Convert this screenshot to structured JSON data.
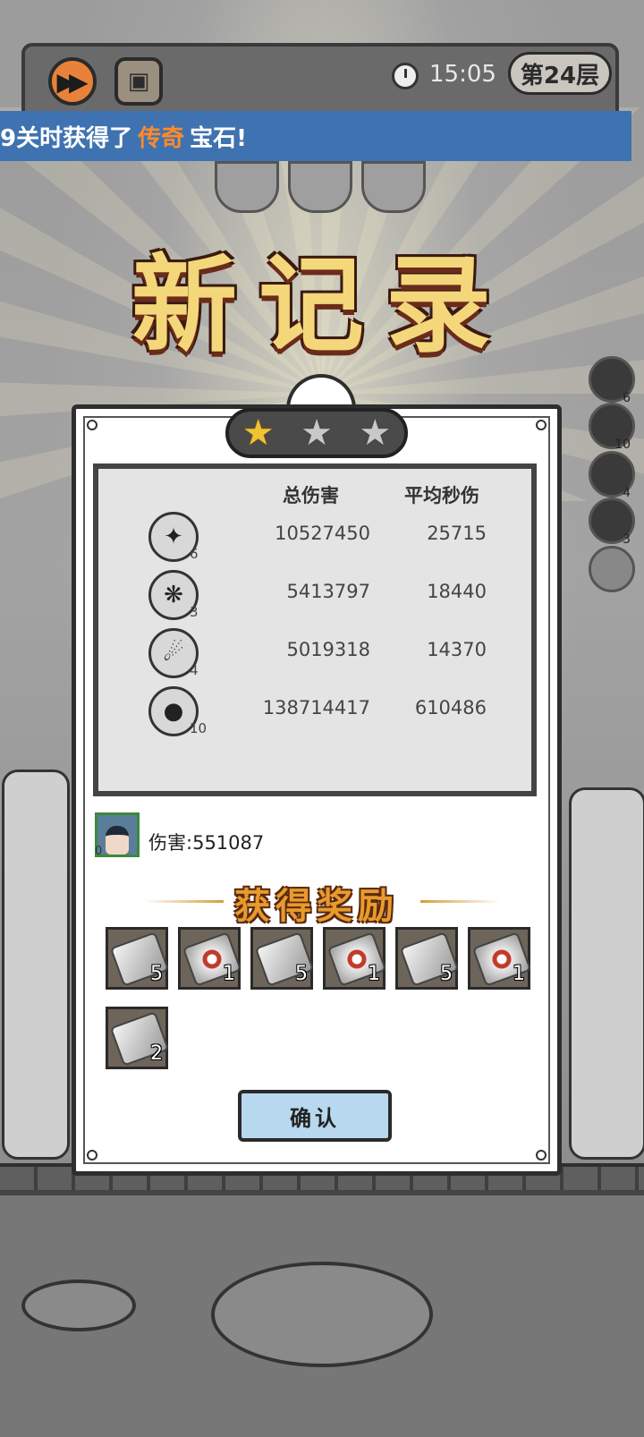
{
  "top_bar": {
    "fast_forward_icon": "fast-forward-icon",
    "chest_icon": "treasure-chest-icon",
    "clock_icon": "clock-icon",
    "time": "15:05",
    "floor": "第24层"
  },
  "banner": {
    "prefix": "9关时获得了",
    "highlight": "传奇",
    "suffix": "宝石!",
    "highlight_color": "#ff8a2a"
  },
  "title": "新记录",
  "stars": {
    "earned": 1,
    "total": 3
  },
  "stats": {
    "headers": {
      "total_damage": "总伤害",
      "avg_dps": "平均秒伤"
    },
    "rows": [
      {
        "icon": "ink-splash-icon",
        "glyph": "✦",
        "level": "6",
        "total": "10527450",
        "dps": "25715"
      },
      {
        "icon": "crystal-cluster-icon",
        "glyph": "❋",
        "level": "3",
        "total": "5413797",
        "dps": "18440"
      },
      {
        "icon": "comet-slash-icon",
        "glyph": "☄",
        "level": "4",
        "total": "5019318",
        "dps": "14370"
      },
      {
        "icon": "bomb-icon",
        "glyph": "●",
        "level": "10",
        "total": "138714417",
        "dps": "610486"
      }
    ]
  },
  "hero": {
    "icon": "hero-avatar",
    "level": "0",
    "damage_label": "伤害:",
    "damage": "551087"
  },
  "rewards": {
    "title": "获得奖励",
    "items": [
      {
        "type": "silver-ore-icon",
        "count": "5"
      },
      {
        "type": "red-gem-ore-icon",
        "count": "1"
      },
      {
        "type": "silver-ore-icon",
        "count": "5"
      },
      {
        "type": "red-gem-ore-icon",
        "count": "1"
      },
      {
        "type": "silver-ore-icon",
        "count": "5"
      },
      {
        "type": "red-gem-ore-icon",
        "count": "1"
      },
      {
        "type": "silver-ore-icon",
        "count": "2"
      }
    ]
  },
  "confirm_label": "确认",
  "side_skills": [
    {
      "icon": "ink-splash-icon",
      "level": "6"
    },
    {
      "icon": "bomb-icon",
      "level": "10"
    },
    {
      "icon": "comet-slash-icon",
      "level": "4"
    },
    {
      "icon": "crystal-cluster-icon",
      "level": "3"
    },
    {
      "icon": "empty-slot-icon",
      "level": ""
    }
  ]
}
